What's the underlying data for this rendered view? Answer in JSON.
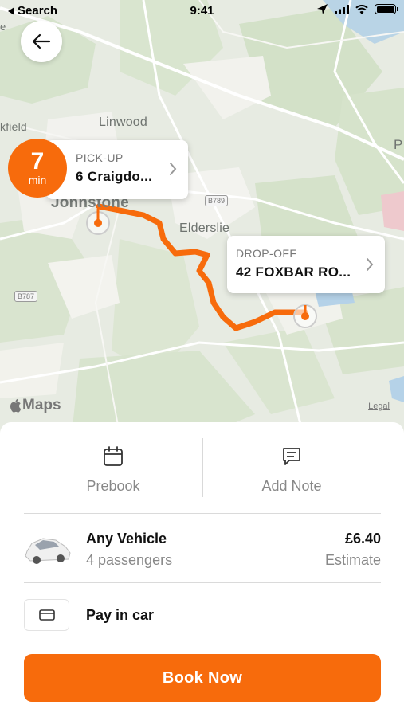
{
  "status_bar": {
    "back_app": "Search",
    "time": "9:41"
  },
  "map": {
    "places": {
      "linwood": "Linwood",
      "johnstone": "Johnstone",
      "elderslie": "Elderslie",
      "kfield": "kfield",
      "edge_p": "P",
      "edge_e": "e"
    },
    "road_shields": {
      "b789": "B789",
      "b787": "B787"
    },
    "maps_brand": "Maps",
    "legal": "Legal"
  },
  "eta": {
    "value": "7",
    "unit": "min"
  },
  "pickup": {
    "label": "PICK-UP",
    "value": "6 Craigdo..."
  },
  "dropoff": {
    "label": "DROP-OFF",
    "value": "42 FOXBAR RO..."
  },
  "actions": {
    "prebook": "Prebook",
    "add_note": "Add Note"
  },
  "vehicle": {
    "name": "Any Vehicle",
    "passengers": "4 passengers",
    "price": "£6.40",
    "price_note": "Estimate"
  },
  "payment": {
    "label": "Pay in car"
  },
  "book_button": "Book Now",
  "colors": {
    "accent": "#f76b0c",
    "route": "#f76b0c"
  },
  "icons": [
    "back-arrow-icon",
    "chevron-right-icon",
    "calendar-icon",
    "note-icon",
    "car-icon",
    "card-icon",
    "location-arrow-icon",
    "wifi-icon",
    "signal-icon",
    "battery-icon"
  ]
}
